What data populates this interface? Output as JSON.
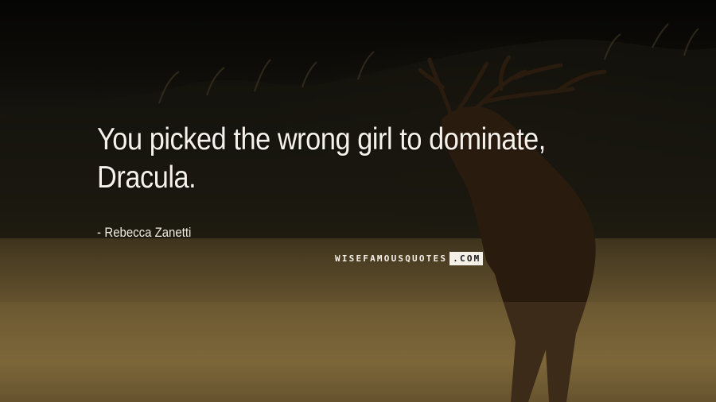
{
  "quote": {
    "text": "You picked the wrong girl to dominate, Dracula."
  },
  "author": {
    "dash": "-",
    "name": "Rebecca Zanetti"
  },
  "watermark": {
    "part_a": "WISEFAMOUSQUOTES",
    "part_b": ".COM"
  },
  "scene": {
    "subject": "stag-silhouette",
    "setting": "grassy-field-at-dusk"
  }
}
